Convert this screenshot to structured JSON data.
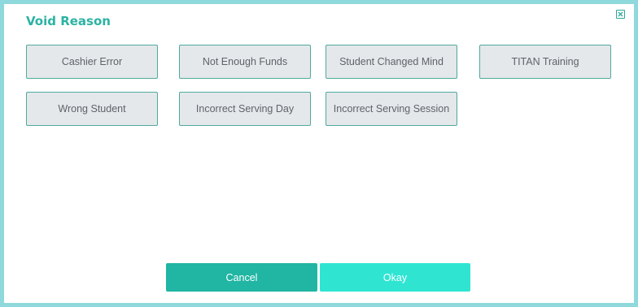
{
  "dialog": {
    "title": "Void Reason"
  },
  "reasons": [
    "Cashier Error",
    "Not Enough Funds",
    "Student Changed Mind",
    "TITAN Training",
    "Wrong Student",
    "Incorrect Serving Day",
    "Incorrect Serving Session"
  ],
  "actions": {
    "cancel_label": "Cancel",
    "okay_label": "Okay"
  },
  "colors": {
    "accent": "#2bb3a3",
    "cancel_bg": "#21b5a3",
    "okay_bg": "#2fe5d2",
    "frame": "#8fd9dc"
  },
  "icons": {
    "close": "close-icon"
  }
}
